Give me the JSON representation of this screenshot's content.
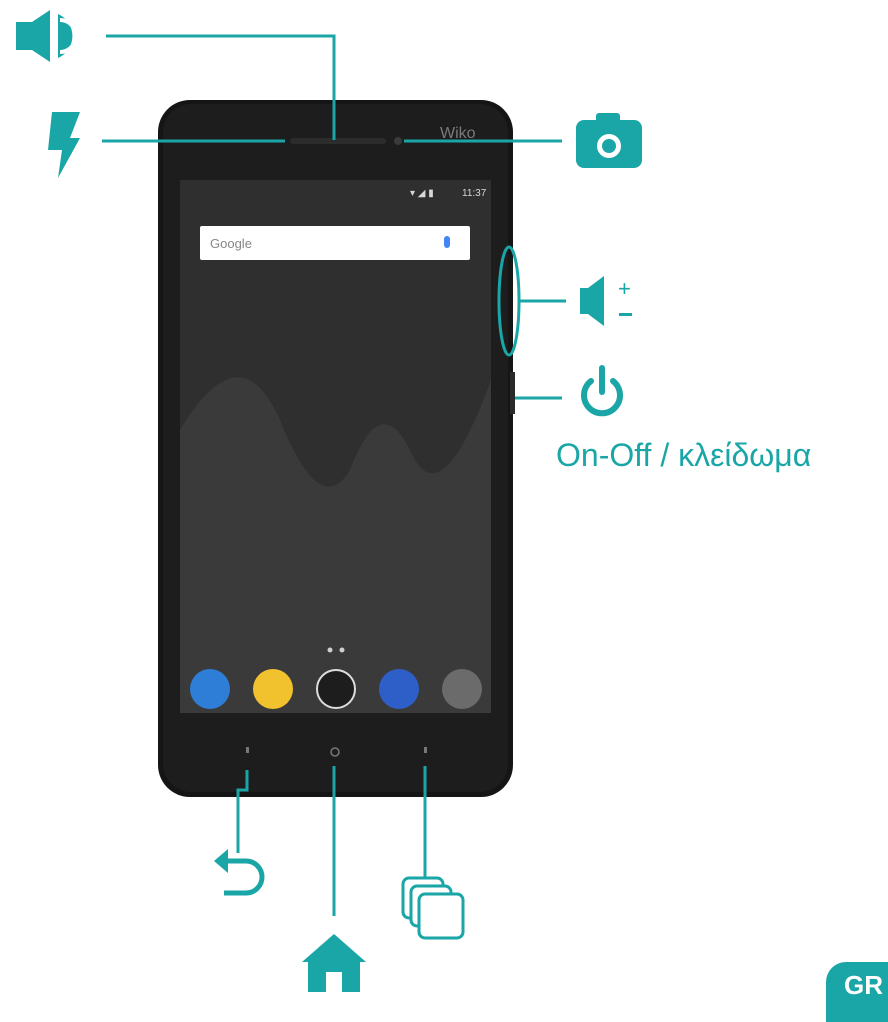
{
  "figure": {
    "title": "",
    "callouts": {
      "power_label": "On-Off / κλείδωμα"
    },
    "phone": {
      "status_time": "11:37",
      "search_text": "Google",
      "brand_mark": "Wiko"
    },
    "badge": "GR",
    "colors": {
      "accent": "#1aa6a6",
      "phone_body": "#151515",
      "screen": "#2f2f2f"
    },
    "icons": [
      "speaker-icon",
      "flash-icon",
      "camera-icon",
      "volume-icon",
      "power-icon",
      "back-icon",
      "home-icon",
      "recent-apps-icon"
    ]
  }
}
